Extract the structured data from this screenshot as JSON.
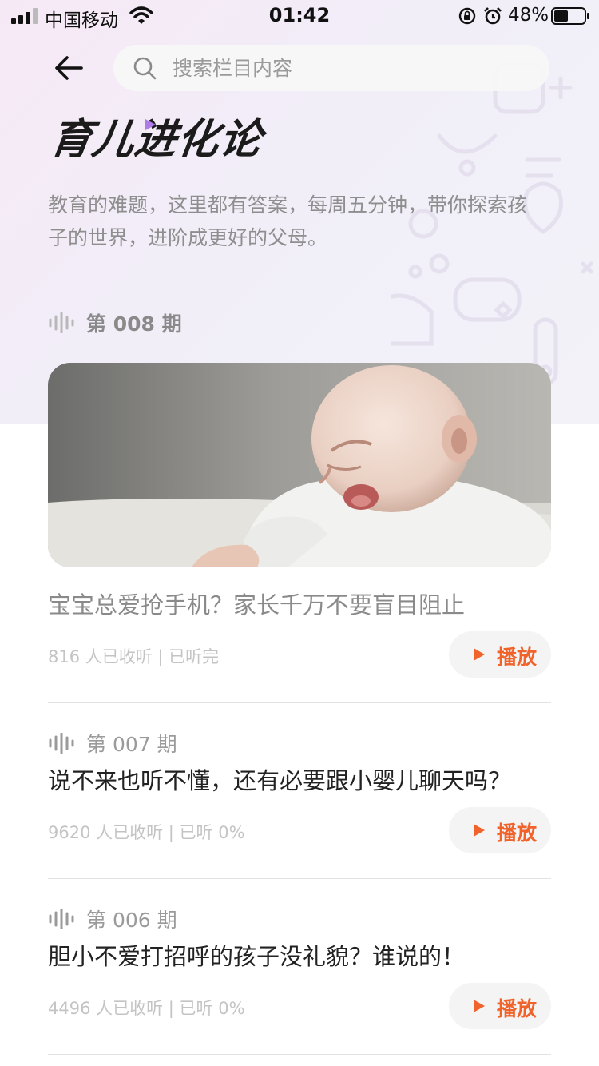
{
  "status_bar": {
    "carrier": "中国移动",
    "time": "01:42",
    "battery_percent": "48%",
    "battery_level": 0.48,
    "icons": [
      "signal-icon",
      "wifi-icon",
      "orientation-lock-icon",
      "alarm-icon",
      "battery-icon"
    ]
  },
  "header": {
    "back_icon": "arrow-left-icon",
    "search_placeholder": "搜索栏目内容",
    "search_value": ""
  },
  "column": {
    "title": "育儿进化论",
    "description": "教育的难题，这里都有答案，每周五分钟，带你探索孩子的世界，进阶成更好的父母。"
  },
  "episodes": [
    {
      "issue": "第 008 期",
      "title": "宝宝总爱抢手机？家长千万不要盲目阻止",
      "meta": "816 人已收听 | 已听完",
      "play_label": "播放"
    },
    {
      "issue": "第 007 期",
      "title": "说不来也听不懂，还有必要跟小婴儿聊天吗？",
      "meta": "9620 人已收听 | 已听 0%",
      "play_label": "播放"
    },
    {
      "issue": "第 006 期",
      "title": "胆小不爱打招呼的孩子没礼貌？谁说的！",
      "meta": "4496 人已收听 | 已听 0%",
      "play_label": "播放"
    }
  ],
  "colors": {
    "accent": "#f0632a",
    "title_text": "#222222",
    "secondary_text": "#8e8e8e",
    "meta_text": "#c4c4c4"
  }
}
